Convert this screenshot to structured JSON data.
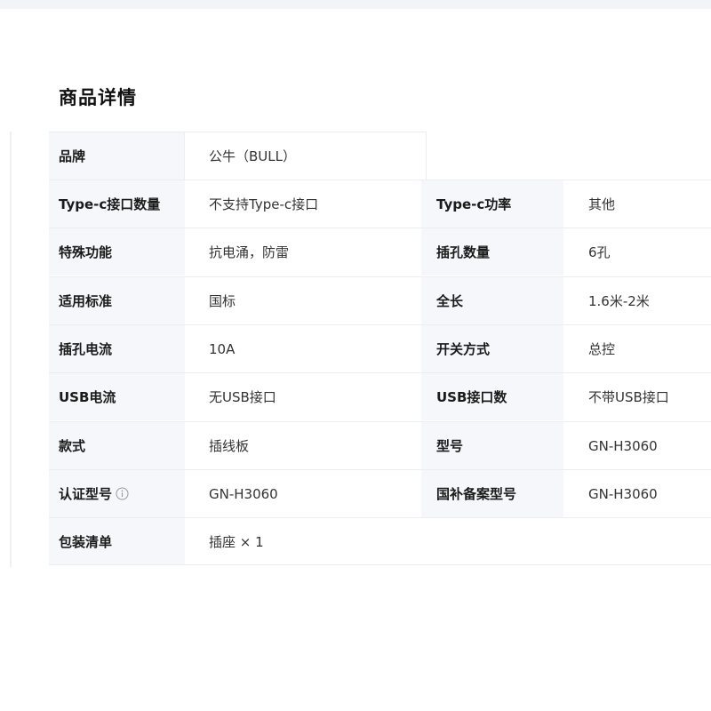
{
  "section": {
    "title": "商品详情"
  },
  "specs": {
    "rows": [
      {
        "label": "品牌",
        "value": "公牛（BULL）"
      },
      {
        "label": "Type-c接口数量",
        "value": "不支持Type-c接口",
        "label2": "Type-c功率",
        "value2": "其他"
      },
      {
        "label": "特殊功能",
        "value": "抗电涌，防雷",
        "label2": "插孔数量",
        "value2": "6孔"
      },
      {
        "label": "适用标准",
        "value": "国标",
        "label2": "全长",
        "value2": "1.6米-2米"
      },
      {
        "label": "插孔电流",
        "value": "10A",
        "label2": "开关方式",
        "value2": "总控"
      },
      {
        "label": "USB电流",
        "value": "无USB接口",
        "label2": "USB接口数",
        "value2": "不带USB接口"
      },
      {
        "label": "款式",
        "value": "插线板",
        "label2": "型号",
        "value2": "GN-H3060"
      },
      {
        "label": "认证型号",
        "value": "GN-H3060",
        "label2": "国补备案型号",
        "value2": "GN-H3060"
      },
      {
        "label": "包装清单",
        "value": "插座 × 1"
      }
    ]
  },
  "icons": {
    "certification_info": "info-icon"
  },
  "colors": {
    "key_background": "#f6f7fa",
    "border": "#ebedf0",
    "top_strip": "#f3f4f8"
  }
}
